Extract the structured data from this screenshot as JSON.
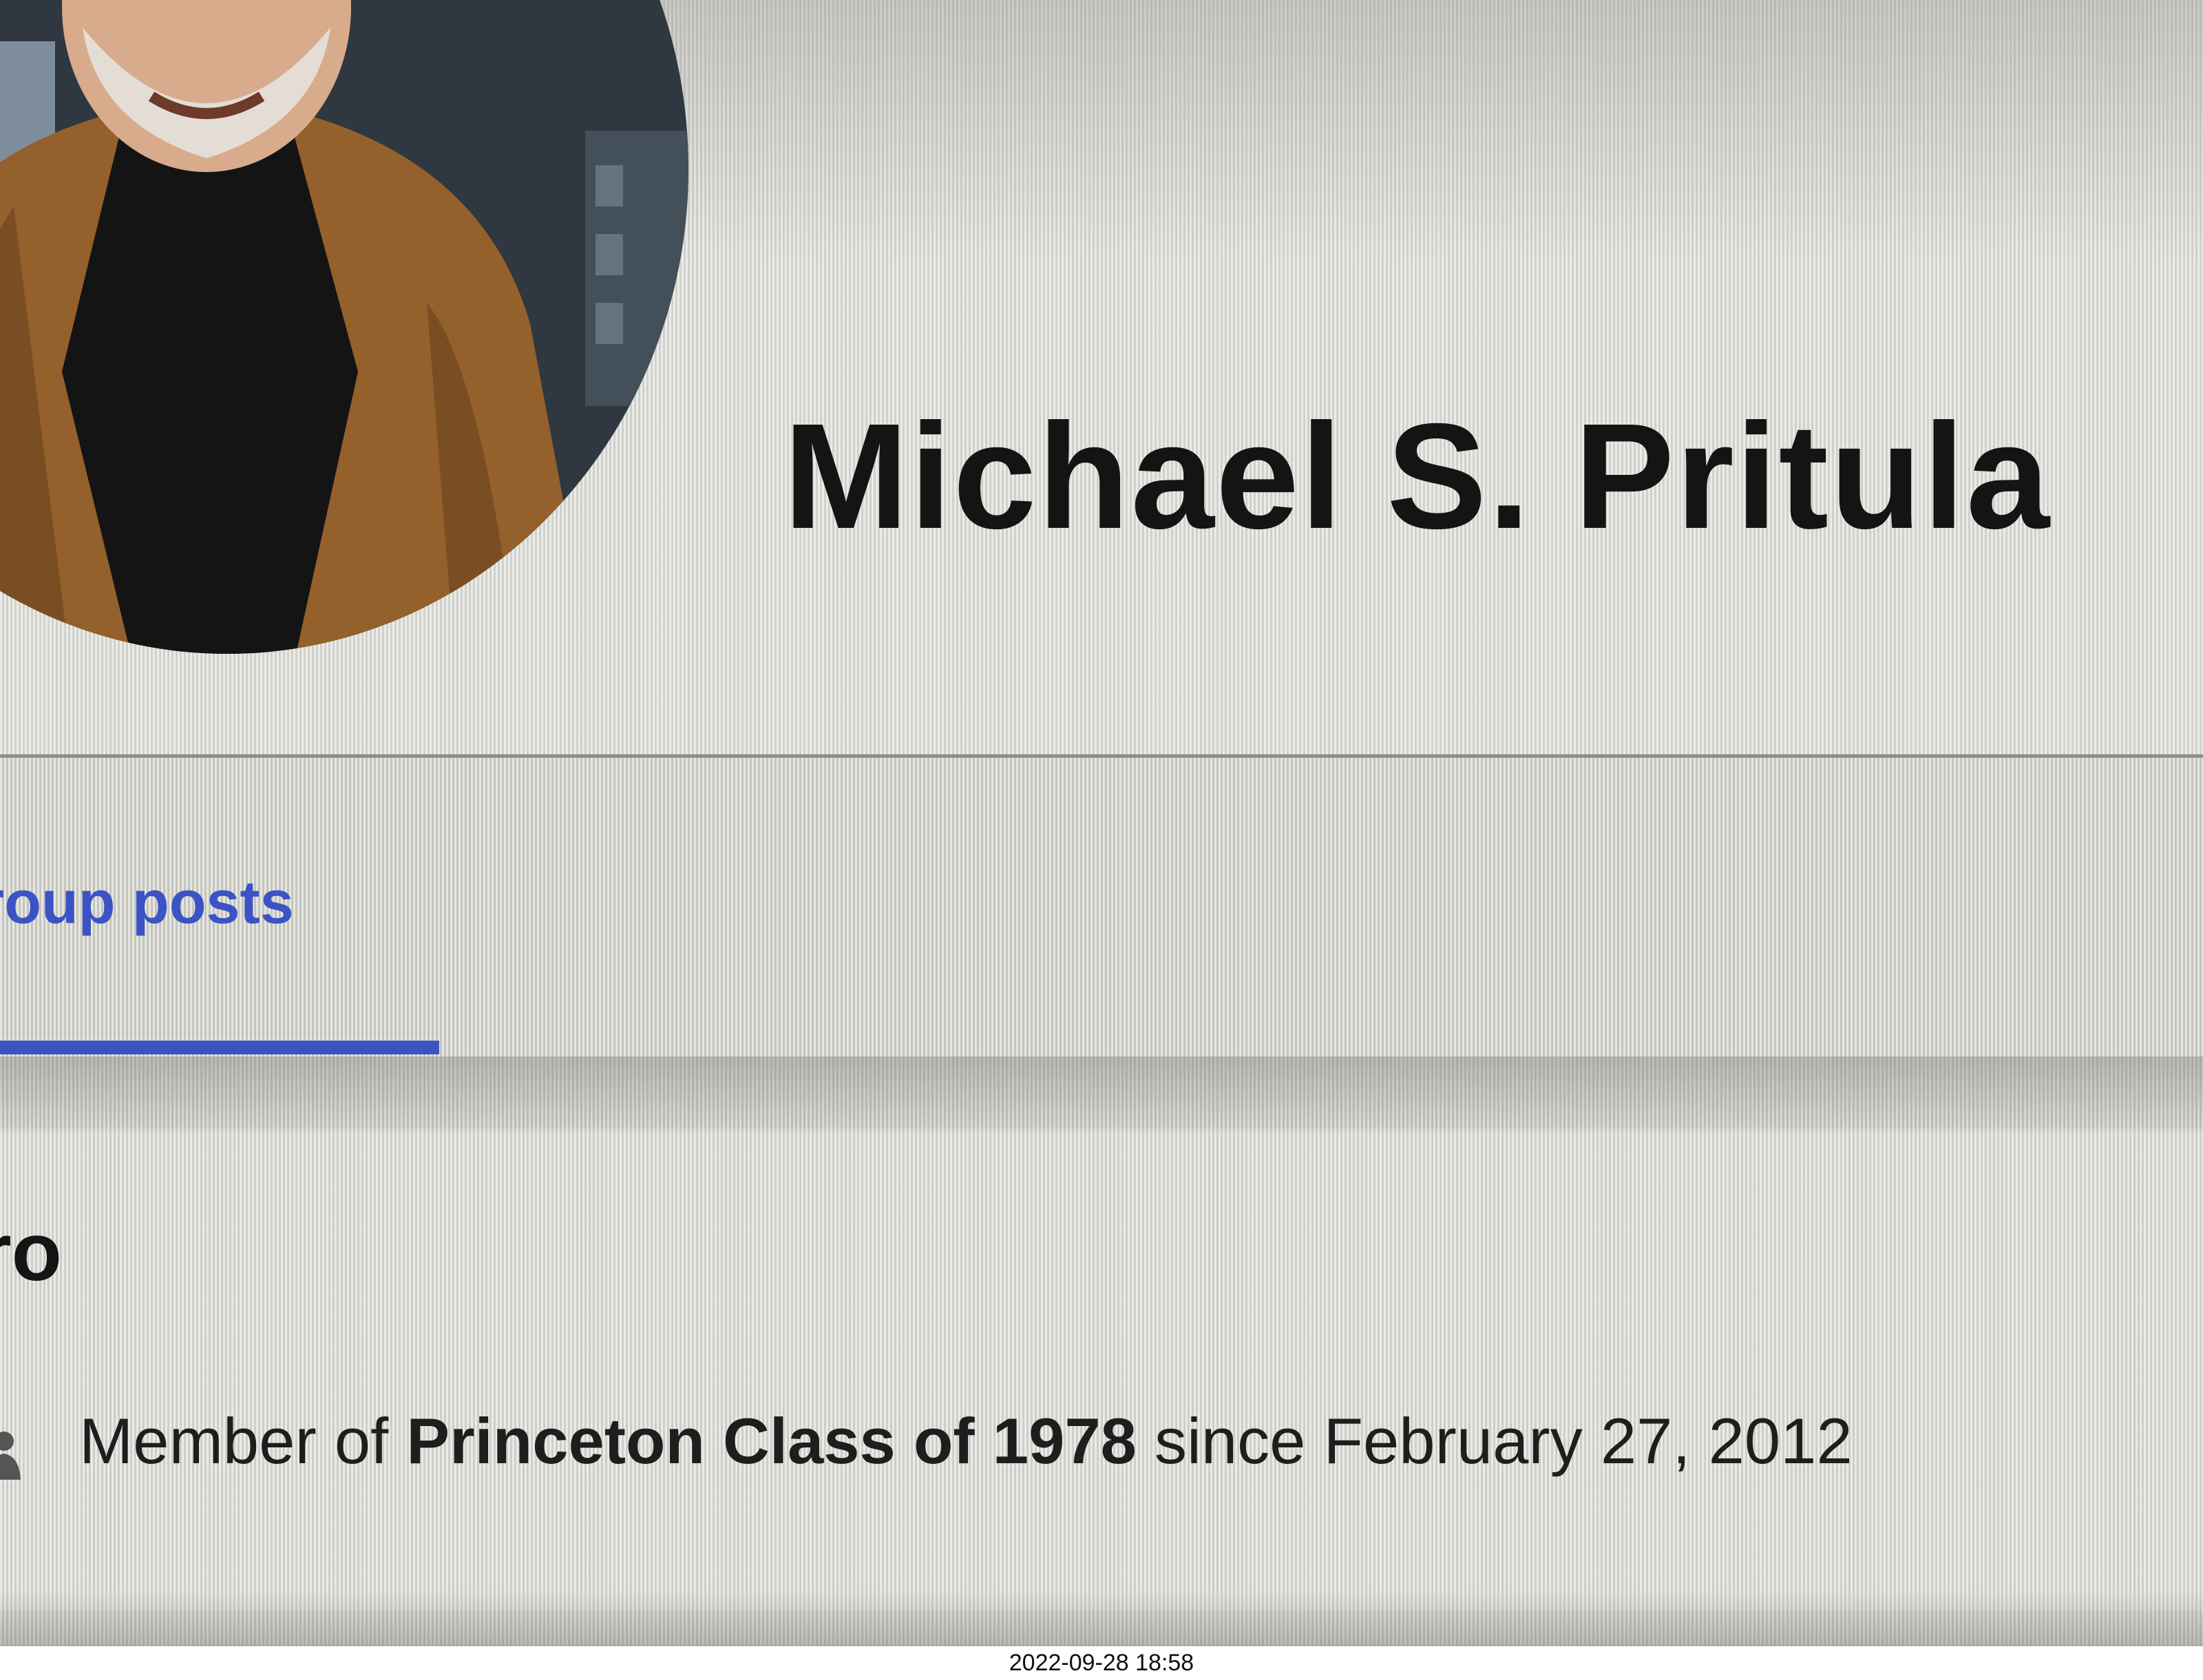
{
  "profile": {
    "name": "Michael S. Pritula"
  },
  "tabs": {
    "active_label": "roup posts"
  },
  "intro": {
    "heading": "tro",
    "membership": {
      "prefix": "Member of ",
      "group": "Princeton Class of 1978",
      "suffix": " since February 27, 2012"
    },
    "icon": "group-icon"
  },
  "photo_timestamp": "2022-09-28 18:58",
  "colors": {
    "accent": "#3b53c4",
    "text": "#141414",
    "divider": "#8e8e88"
  }
}
